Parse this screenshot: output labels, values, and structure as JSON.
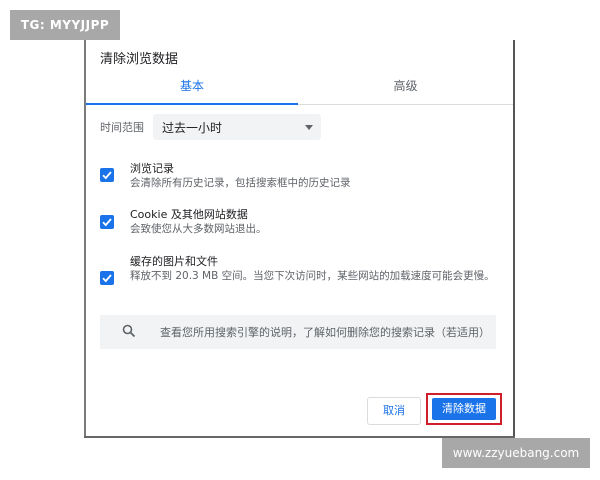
{
  "watermarks": {
    "top_left": "TG: MYYJJPP",
    "bottom_right": "www.zzyuebang.com"
  },
  "dialog": {
    "title": "清除浏览数据",
    "tabs": [
      {
        "label": "基本",
        "active": true
      },
      {
        "label": "高级",
        "active": false
      }
    ],
    "time_range": {
      "label": "时间范围",
      "value": "过去一小时"
    },
    "options": [
      {
        "title": "浏览记录",
        "description": "会清除所有历史记录，包括搜索框中的历史记录",
        "checked": true
      },
      {
        "title": "Cookie 及其他网站数据",
        "description": "会致使您从大多数网站退出。",
        "checked": true
      },
      {
        "title": "缓存的图片和文件",
        "description": "释放不到 20.3 MB 空间。当您下次访问时，某些网站的加载速度可能会更慢。",
        "checked": true
      }
    ],
    "search_info": "查看您所用搜索引擎的说明，了解如何删除您的搜索记录（若适用）",
    "buttons": {
      "cancel": "取消",
      "clear": "清除数据"
    },
    "colors": {
      "accent": "#1a73e8",
      "highlight_border": "#d01e2a"
    }
  }
}
